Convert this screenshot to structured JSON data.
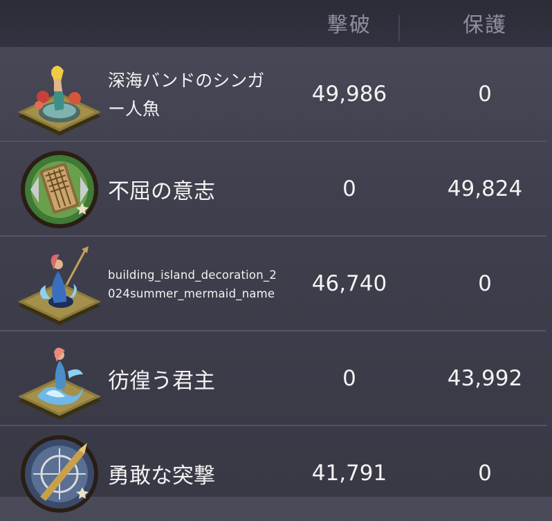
{
  "header": {
    "col_defeat": "撃破",
    "col_protect": "保護"
  },
  "rows": [
    {
      "icon": "mermaid-singer-statue-icon",
      "name": "深海バンドのシンガー人魚",
      "defeat": "49,986",
      "protect": "0"
    },
    {
      "icon": "shield-gate-emblem-icon",
      "name": "不屈の意志",
      "defeat": "0",
      "protect": "49,824"
    },
    {
      "icon": "mermaid-trident-statue-icon",
      "name": "building_island_decoration_2024summer_mermaid_name",
      "defeat": "46,740",
      "protect": "0"
    },
    {
      "icon": "wandering-lord-statue-icon",
      "name": "彷徨う君主",
      "defeat": "0",
      "protect": "43,992"
    },
    {
      "icon": "crosshair-bullet-emblem-icon",
      "name": "勇敢な突撃",
      "defeat": "41,791",
      "protect": "0"
    }
  ],
  "colors": {
    "text": "#f3f3f3",
    "header_text": "#8f8fa0",
    "background": "#43434f"
  }
}
